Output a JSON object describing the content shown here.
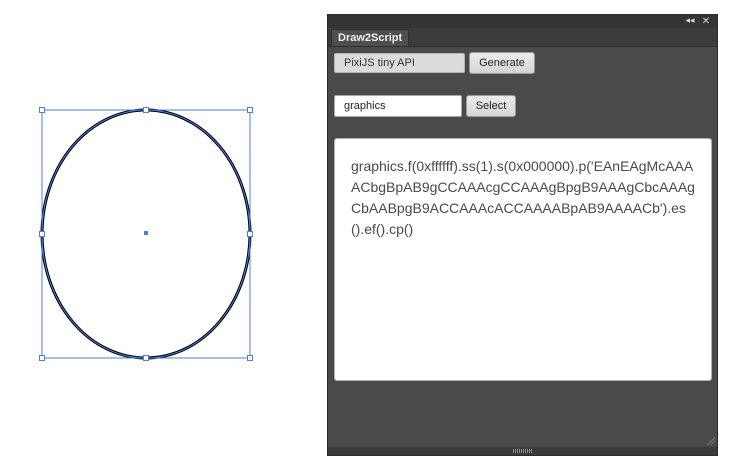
{
  "panel": {
    "collapse_glyph": "◂◂",
    "close_glyph": "✕",
    "tab_label": "Draw2Script",
    "api_selected": "PixiJS tiny API",
    "generate_label": "Generate",
    "variable_value": "graphics",
    "select_label": "Select",
    "output_code": "graphics.f(0xffffff).ss(1).s(0x000000).p('EAnEAgMcAAAACbgBpAB9gCCAAAcgCCAAAgBpgB9AAAgCbcAAAgCbAABpgB9ACCAAAcACCAAAABpAB9AAAACb').es().ef().cp()"
  },
  "canvas": {
    "shape": "ellipse",
    "fill_color": "#ffffff",
    "stroke_color": "#000000",
    "selection_color": "#4a7fe0"
  },
  "icons": {
    "collapse": "double-chevron-left-icon",
    "close": "close-icon"
  }
}
